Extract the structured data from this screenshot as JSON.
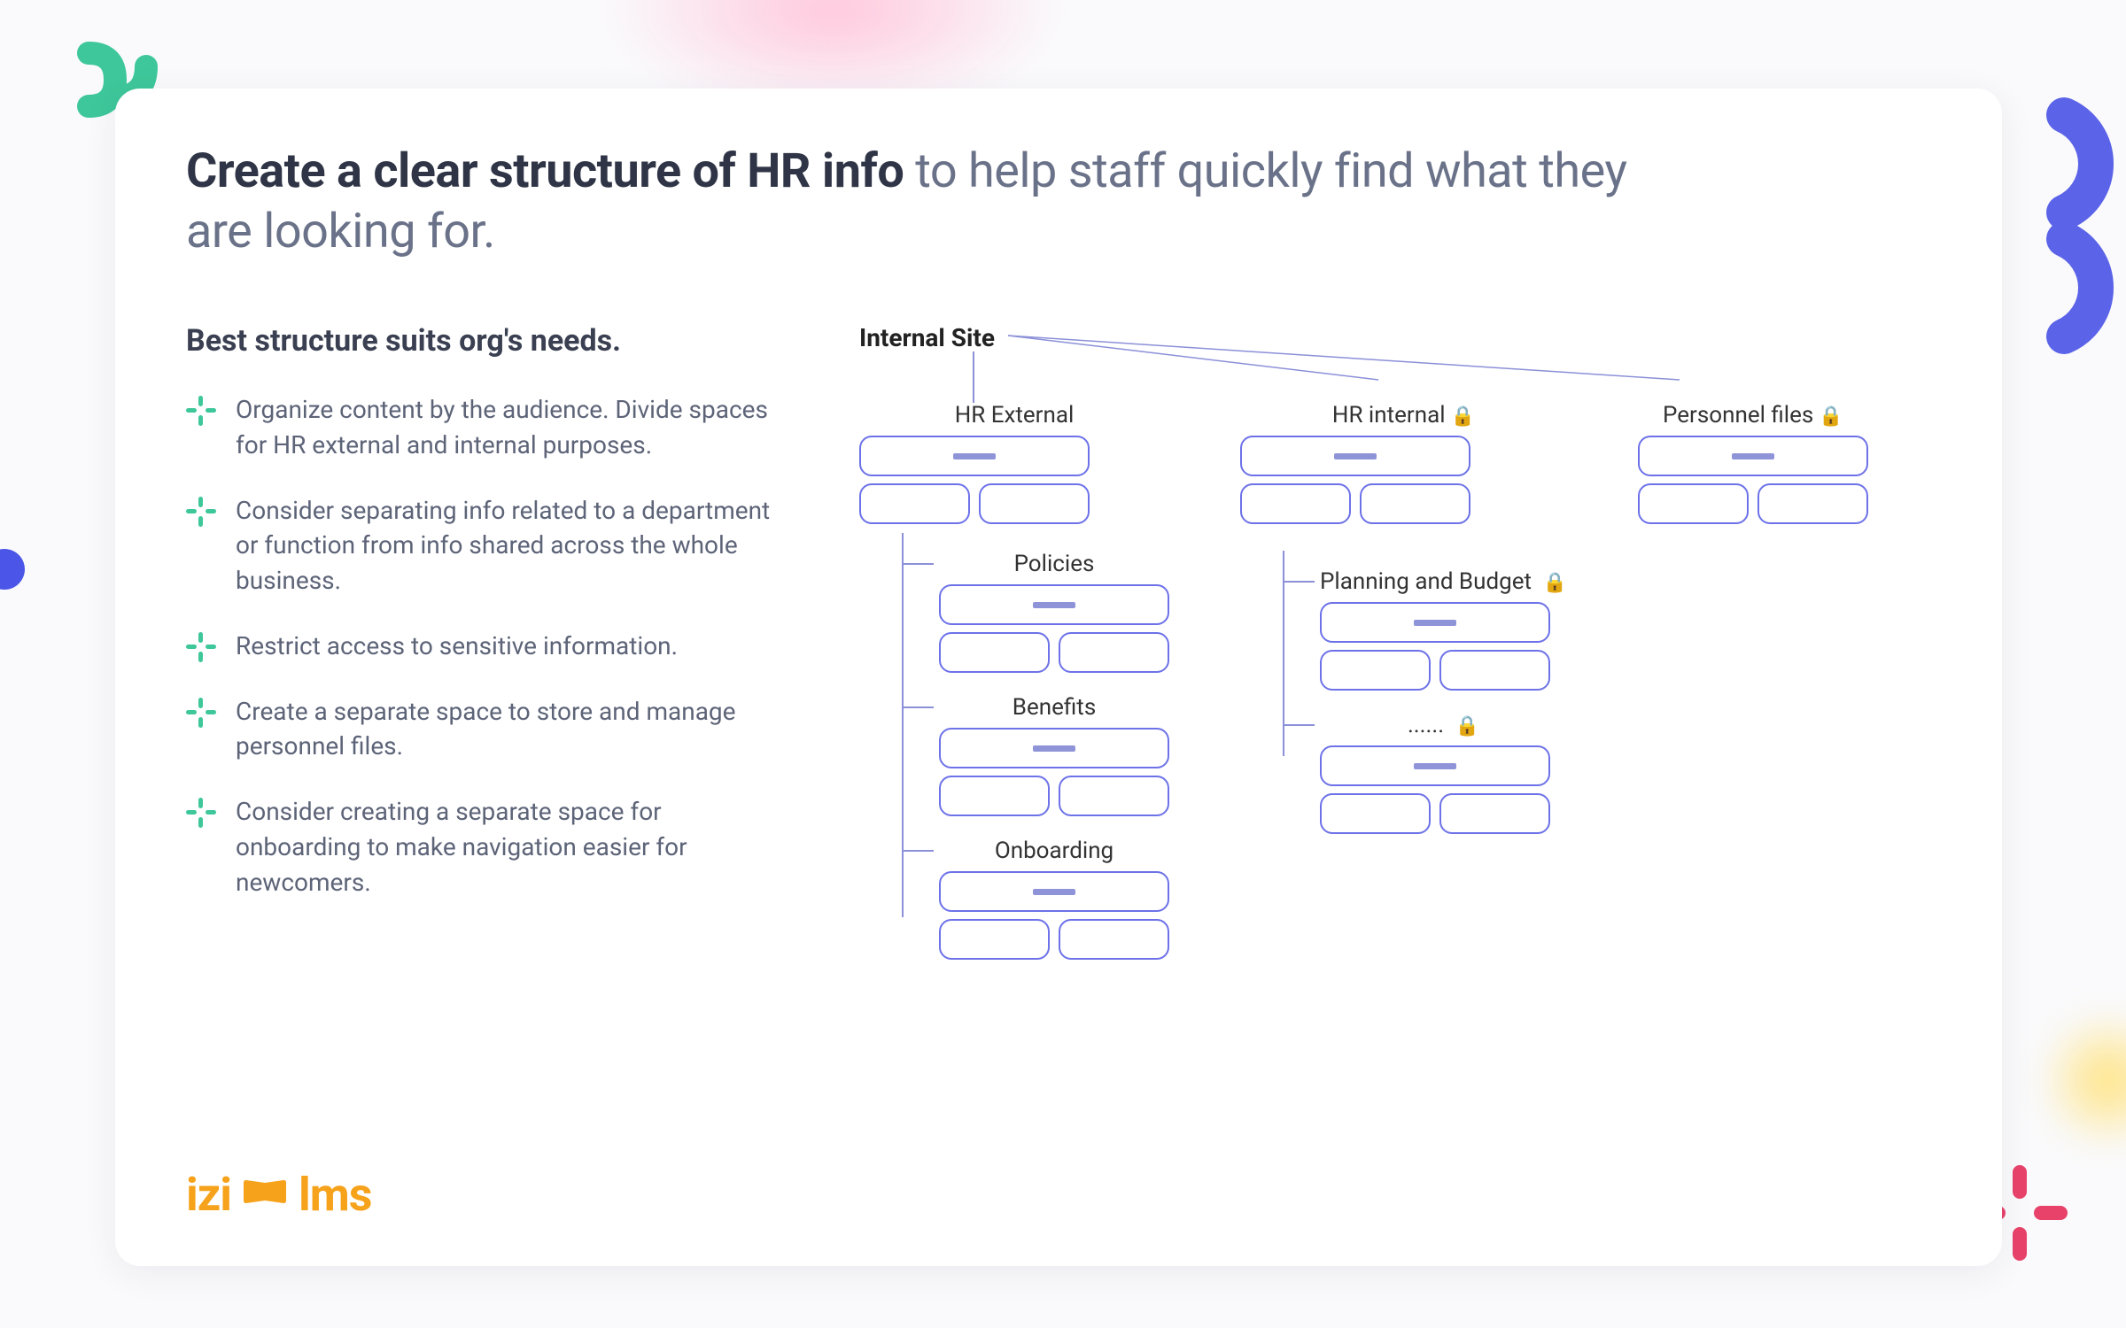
{
  "headline_bold": "Create a clear structure of HR info",
  "headline_rest": " to help staff quickly find what they are looking for.",
  "subhead": "Best structure suits org's needs.",
  "bullets": [
    "Organize content by the audience. Divide spaces for HR external and internal purposes.",
    "Consider separating info related to a department or function from info shared across the whole business.",
    "Restrict access to sensitive information.",
    "Create a separate space to store and manage personnel files.",
    "Consider creating a separate space for onboarding to make navigation easier for newcomers."
  ],
  "logo": {
    "left": "izi",
    "right": "lms"
  },
  "tree": {
    "root": "Internal Site",
    "top_nodes": [
      {
        "label": "HR External",
        "locked": false
      },
      {
        "label": "HR internal",
        "locked": true
      },
      {
        "label": "Personnel files",
        "locked": true
      }
    ],
    "left_children": [
      {
        "label": "Policies",
        "locked": false
      },
      {
        "label": "Benefits",
        "locked": false
      },
      {
        "label": "Onboarding",
        "locked": false
      }
    ],
    "right_children": [
      {
        "label": "Planning and Budget",
        "locked": true
      },
      {
        "label": "......",
        "locked": true
      }
    ]
  }
}
